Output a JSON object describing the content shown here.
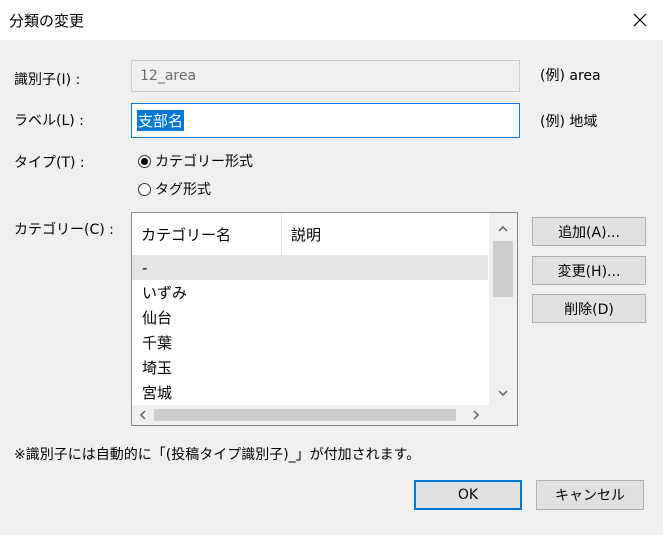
{
  "dialog": {
    "title": "分類の変更"
  },
  "identifier": {
    "label": "識別子(I) :",
    "value": "12_area",
    "example": "(例) area"
  },
  "display_label": {
    "label": "ラベル(L) :",
    "value": "支部名",
    "example": "(例) 地域"
  },
  "type": {
    "label": "タイプ(T) :",
    "options": [
      {
        "label": "カテゴリー形式",
        "checked": true
      },
      {
        "label": "タグ形式",
        "checked": false
      }
    ]
  },
  "categories": {
    "label": "カテゴリー(C) :",
    "columns": [
      "カテゴリー名",
      "説明"
    ],
    "rows": [
      "-",
      "いずみ",
      "仙台",
      "千葉",
      "埼玉",
      "宮城"
    ],
    "selected_index": 0
  },
  "side_buttons": {
    "add": "追加(A)...",
    "edit": "変更(H)...",
    "delete": "削除(D)"
  },
  "note": "※識別子には自動的に「(投稿タイプ識別子)_」が付加されます。",
  "footer": {
    "ok": "OK",
    "cancel": "キャンセル"
  }
}
